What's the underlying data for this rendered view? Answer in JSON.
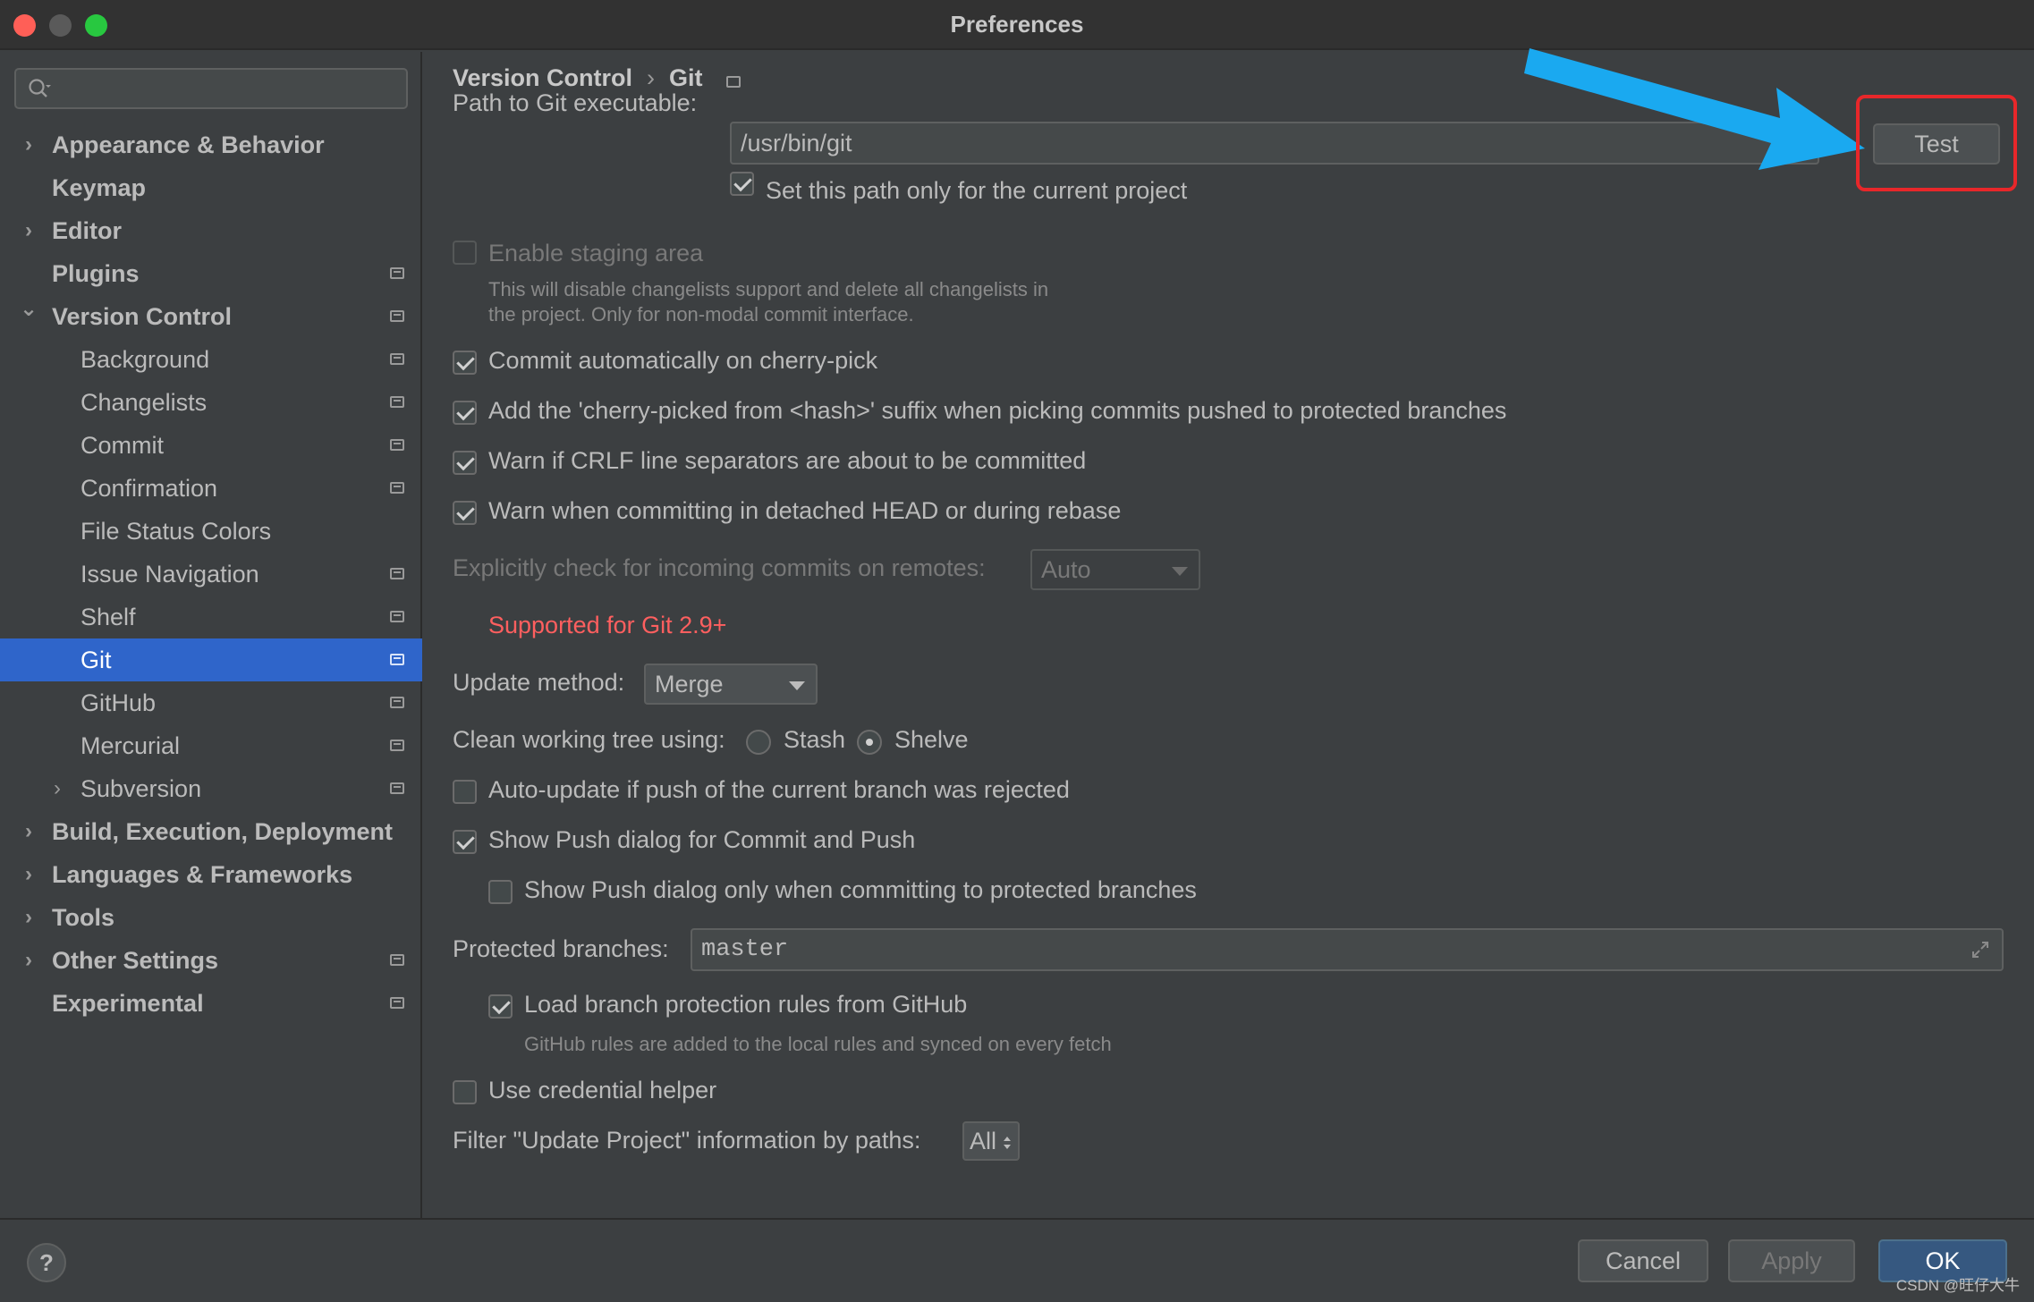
{
  "window": {
    "title": "Preferences"
  },
  "sidebar": {
    "search_placeholder": "",
    "items": [
      {
        "label": "Appearance & Behavior",
        "level": 0,
        "bold": true,
        "expander": "collapsed",
        "project": false
      },
      {
        "label": "Keymap",
        "level": 0,
        "bold": true,
        "expander": "none",
        "project": false
      },
      {
        "label": "Editor",
        "level": 0,
        "bold": true,
        "expander": "collapsed",
        "project": false
      },
      {
        "label": "Plugins",
        "level": 0,
        "bold": true,
        "expander": "none",
        "project": true
      },
      {
        "label": "Version Control",
        "level": 0,
        "bold": true,
        "expander": "expanded",
        "project": true
      },
      {
        "label": "Background",
        "level": 1,
        "bold": false,
        "expander": "none",
        "project": true
      },
      {
        "label": "Changelists",
        "level": 1,
        "bold": false,
        "expander": "none",
        "project": true
      },
      {
        "label": "Commit",
        "level": 1,
        "bold": false,
        "expander": "none",
        "project": true
      },
      {
        "label": "Confirmation",
        "level": 1,
        "bold": false,
        "expander": "none",
        "project": true
      },
      {
        "label": "File Status Colors",
        "level": 1,
        "bold": false,
        "expander": "none",
        "project": false
      },
      {
        "label": "Issue Navigation",
        "level": 1,
        "bold": false,
        "expander": "none",
        "project": true
      },
      {
        "label": "Shelf",
        "level": 1,
        "bold": false,
        "expander": "none",
        "project": true
      },
      {
        "label": "Git",
        "level": 1,
        "bold": false,
        "expander": "none",
        "project": true,
        "selected": true
      },
      {
        "label": "GitHub",
        "level": 1,
        "bold": false,
        "expander": "none",
        "project": true
      },
      {
        "label": "Mercurial",
        "level": 1,
        "bold": false,
        "expander": "none",
        "project": true
      },
      {
        "label": "Subversion",
        "level": 1,
        "bold": false,
        "expander": "collapsed",
        "project": true
      },
      {
        "label": "Build, Execution, Deployment",
        "level": 0,
        "bold": true,
        "expander": "collapsed",
        "project": false
      },
      {
        "label": "Languages & Frameworks",
        "level": 0,
        "bold": true,
        "expander": "collapsed",
        "project": false
      },
      {
        "label": "Tools",
        "level": 0,
        "bold": true,
        "expander": "collapsed",
        "project": false
      },
      {
        "label": "Other Settings",
        "level": 0,
        "bold": true,
        "expander": "collapsed",
        "project": true
      },
      {
        "label": "Experimental",
        "level": 0,
        "bold": true,
        "expander": "none",
        "project": true
      }
    ]
  },
  "breadcrumb": {
    "parent": "Version Control",
    "separator": "›",
    "current": "Git"
  },
  "git": {
    "path_label": "Path to Git executable:",
    "path_value": "/usr/bin/git",
    "test_label": "Test",
    "path_current_project_label": "Set this path only for the current project",
    "path_current_project_checked": true,
    "staging_label": "Enable staging area",
    "staging_hint_1": "This will disable changelists support and delete all changelists in",
    "staging_hint_2": "the project. Only for non-modal commit interface.",
    "cherry_pick_auto_label": "Commit automatically on cherry-pick",
    "cherry_pick_suffix_label": "Add the 'cherry-picked from <hash>' suffix when picking commits pushed to protected branches",
    "crlf_label": "Warn if CRLF line separators are about to be committed",
    "detached_label": "Warn when committing in detached HEAD or during rebase",
    "incoming_label": "Explicitly check for incoming commits on remotes:",
    "incoming_value": "Auto",
    "incoming_error": "Supported for Git 2.9+",
    "update_method_label": "Update method:",
    "update_method_value": "Merge",
    "clean_tree_label": "Clean working tree using:",
    "stash_label": "Stash",
    "shelve_label": "Shelve",
    "clean_tree_selected": "Shelve",
    "auto_update_label": "Auto-update if push of the current branch was rejected",
    "show_push_label": "Show Push dialog for Commit and Push",
    "show_push_protected_label": "Show Push dialog only when committing to protected branches",
    "protected_label": "Protected branches:",
    "protected_value": "master",
    "load_rules_label": "Load branch protection rules from GitHub",
    "load_rules_hint": "GitHub rules are added to the local rules and synced on every fetch",
    "credential_label": "Use credential helper",
    "filter_label": "Filter \"Update Project\" information by paths:",
    "filter_value": "All"
  },
  "footer": {
    "help": "?",
    "cancel": "Cancel",
    "apply": "Apply",
    "ok": "OK",
    "watermark": "CSDN @旺仔大牛"
  },
  "colors": {
    "background": "#3c3f41",
    "selection": "#2f65ca",
    "error": "#ff5f5f",
    "annotation_arrow": "#1aa9f0",
    "annotation_box": "#e8272a"
  }
}
